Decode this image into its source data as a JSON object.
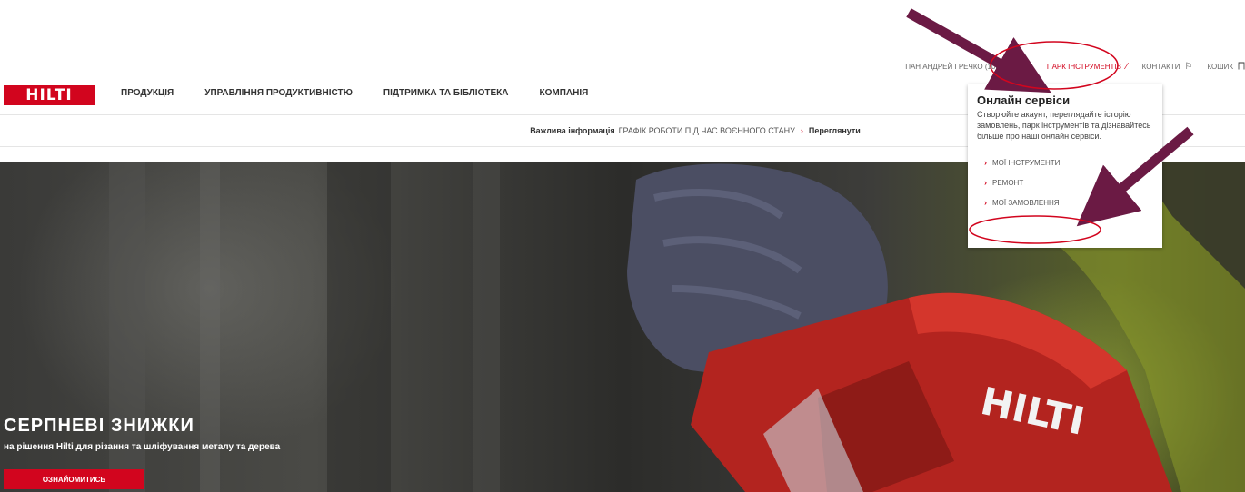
{
  "utility": {
    "user": "ПАН АНДРЕЙ ГРЕЧКО (10039402)",
    "tools": "ПАРК ІНСТРУМЕНТІВ",
    "contacts": "КОНТАКТИ",
    "cart": "КОШИК"
  },
  "logo": "HILTI",
  "nav": [
    "ПРОДУКЦІЯ",
    "УПРАВЛІННЯ ПРОДУКТИВНІСТЮ",
    "ПІДТРИМКА ТА БІБЛІОТЕКА",
    "КОМПАНІЯ"
  ],
  "info": {
    "label": "Важлива інформація",
    "notice": "ГРАФІК РОБОТИ ПІД ЧАС ВОЄННОГО СТАНУ",
    "link": "Переглянути"
  },
  "dropdown": {
    "title": "Онлайн сервіси",
    "desc": "Створюйте акаунт, переглядайте історію замовлень, парк інструментів та дізнавайтесь більше про наші онлайн сервіси.",
    "links": [
      "МОЇ ІНСТРУМЕНТИ",
      "РЕМОНТ",
      "МОЇ ЗАМОВЛЕННЯ"
    ]
  },
  "hero": {
    "title": "СЕРПНЕВІ ЗНИЖКИ",
    "subtitle": "на рішення Hilti для різання та шліфування металу та дерева",
    "button": "ОЗНАЙОМИТИСЬ",
    "product_logo": "HILTI"
  },
  "colors": {
    "brand": "#d2051e",
    "annotation": "#6b1a44",
    "annotation_circle": "#d2051e"
  }
}
